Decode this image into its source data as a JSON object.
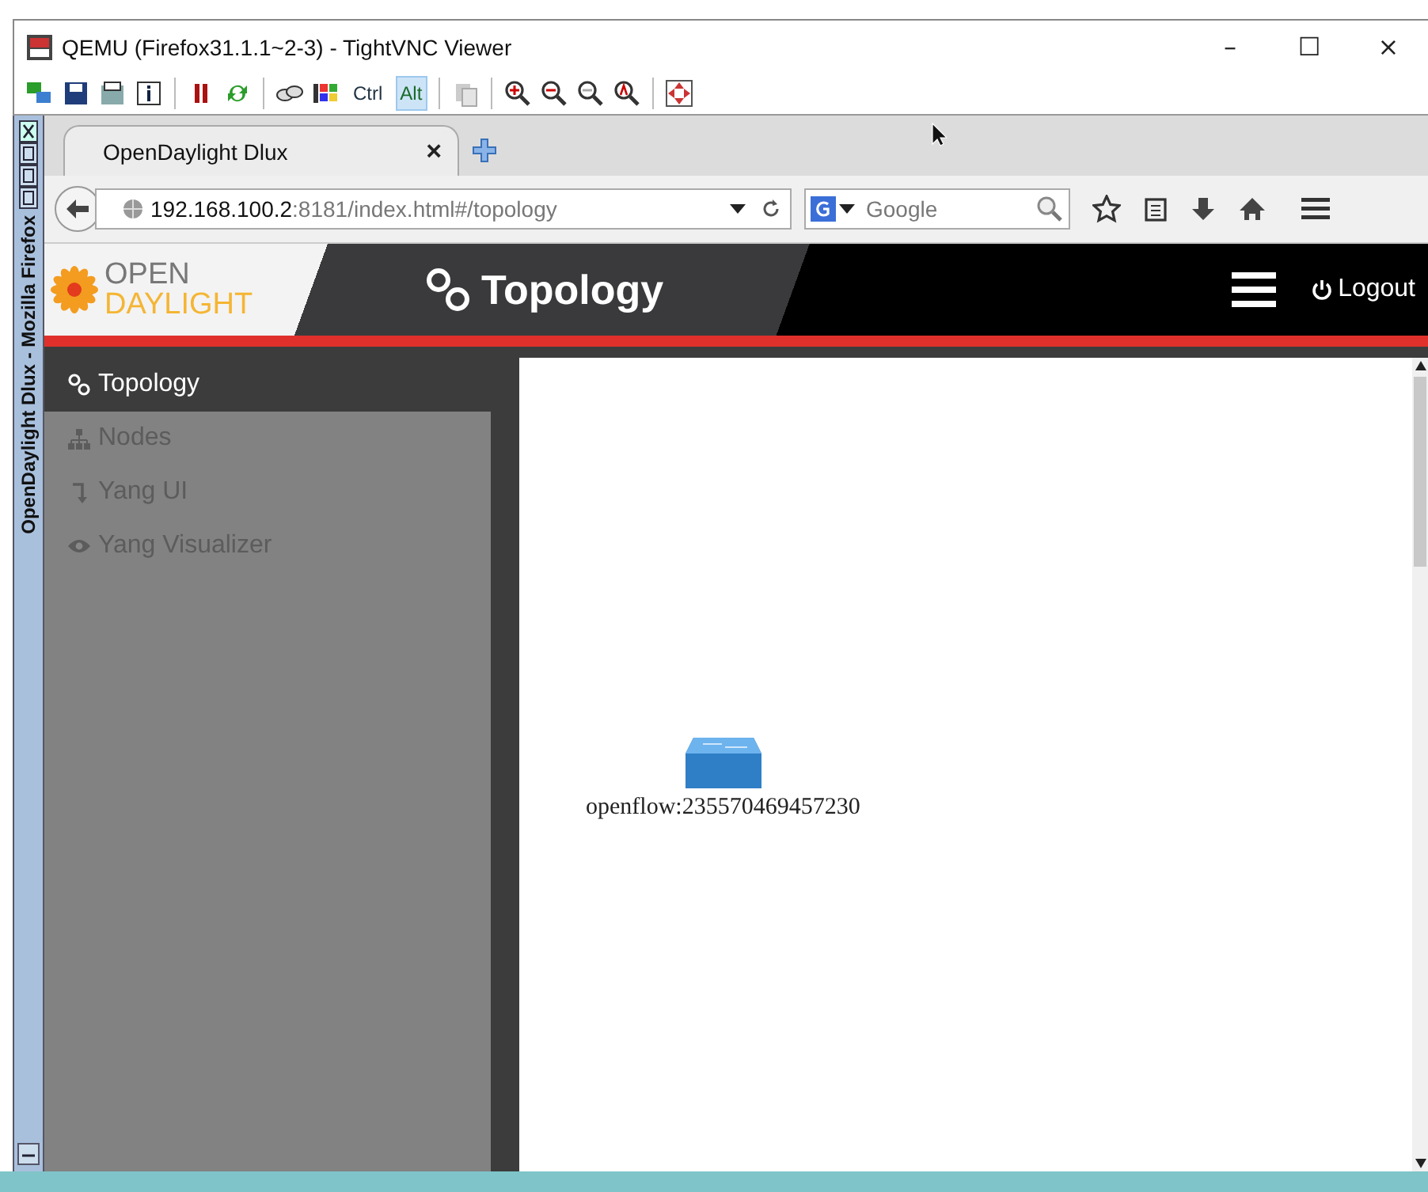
{
  "window": {
    "title": "QEMU (Firefox31.1.1~2-3) - TightVNC Viewer",
    "controls": [
      "–",
      "☐",
      "×"
    ]
  },
  "toolbar": {
    "keys": [
      {
        "label": "Ctrl",
        "selected": false
      },
      {
        "label": "Alt",
        "selected": true
      }
    ]
  },
  "firefox": {
    "side_title": "OpenDaylight Dlux - Mozilla Firefox",
    "tabs": [
      {
        "label": "OpenDaylight Dlux",
        "close": "×"
      }
    ],
    "url": {
      "host": "192.168.100.2",
      "path": ":8181/index.html#/topology"
    },
    "search": {
      "placeholder": "Google"
    }
  },
  "app": {
    "logo": {
      "top": "OPEN",
      "bottom": "DAYLIGHT"
    },
    "page_title": "Topology",
    "logout": "Logout",
    "sidebar": [
      {
        "label": "Topology",
        "kind": "topology",
        "selected": true
      },
      {
        "label": "Nodes",
        "kind": "nodes",
        "selected": false
      },
      {
        "label": "Yang UI",
        "kind": "yang",
        "selected": false
      },
      {
        "label": "Yang Visualizer",
        "kind": "eye",
        "selected": false
      }
    ],
    "topology": {
      "nodes": [
        {
          "label": "openflow:235570469457230",
          "kind": "switch"
        }
      ]
    }
  }
}
